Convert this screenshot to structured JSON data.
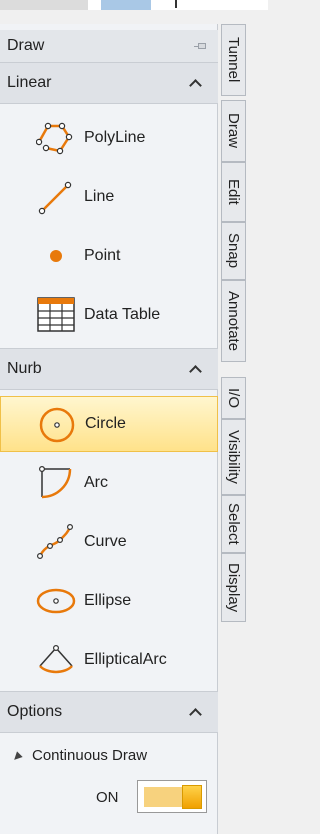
{
  "panel": {
    "title": "Draw"
  },
  "sections": {
    "linear": {
      "label": "Linear",
      "items": [
        {
          "label": "PolyLine",
          "icon": "polyline-icon"
        },
        {
          "label": "Line",
          "icon": "line-icon"
        },
        {
          "label": "Point",
          "icon": "point-icon"
        },
        {
          "label": "Data Table",
          "icon": "data-table-icon"
        }
      ]
    },
    "nurb": {
      "label": "Nurb",
      "items": [
        {
          "label": "Circle",
          "icon": "circle-icon",
          "selected": true
        },
        {
          "label": "Arc",
          "icon": "arc-icon"
        },
        {
          "label": "Curve",
          "icon": "curve-icon"
        },
        {
          "label": "Ellipse",
          "icon": "ellipse-icon"
        },
        {
          "label": "EllipticalArc",
          "icon": "elliptical-arc-icon"
        }
      ]
    },
    "options": {
      "label": "Options",
      "continuous_draw": {
        "label": "Continuous Draw",
        "value": "ON"
      }
    }
  },
  "side_tabs": [
    "Tunnel",
    "Draw",
    "Edit",
    "Snap",
    "Annotate",
    "I/O",
    "Visibility",
    "Select",
    "Display"
  ],
  "colors": {
    "accent_orange": "#e8790b",
    "selected_bg": "#ffe28a",
    "header_bg": "#dfe2e7"
  }
}
